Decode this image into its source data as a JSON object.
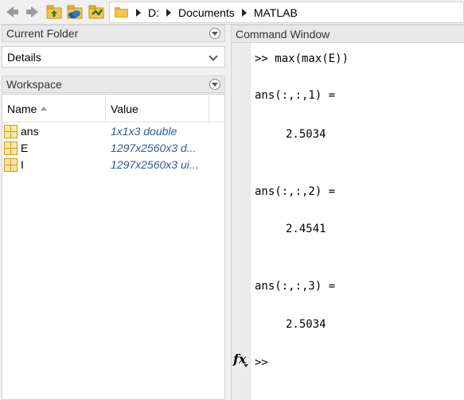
{
  "toolbar": {
    "back_icon": "back-arrow-icon",
    "forward_icon": "forward-arrow-icon",
    "up_icon": "up-folder-icon",
    "browse_icon": "browse-folder-icon",
    "path": [
      "D:",
      "Documents",
      "MATLAB"
    ]
  },
  "current_folder": {
    "title": "Current Folder",
    "details_label": "Details"
  },
  "workspace": {
    "title": "Workspace",
    "columns": {
      "name": "Name",
      "value": "Value"
    },
    "rows": [
      {
        "name": "ans",
        "value": "1x1x3 double"
      },
      {
        "name": "E",
        "value": "1297x2560x3 d..."
      },
      {
        "name": "I",
        "value": "1297x2560x3 ui..."
      }
    ]
  },
  "command_window": {
    "title": "Command Window",
    "command_line": ">> max(max(E))",
    "outputs": [
      {
        "label": "ans(:,:,1) =",
        "value": "2.5034"
      },
      {
        "label": "ans(:,:,2) =",
        "value": "2.4541"
      },
      {
        "label": "ans(:,:,3) =",
        "value": "2.5034"
      }
    ],
    "prompt": ">>",
    "fx_label": "fx"
  },
  "colors": {
    "variable_value": "#2b5c9c",
    "folder_icon": "#f6c64a",
    "variable_icon": "#fbe6a3"
  }
}
